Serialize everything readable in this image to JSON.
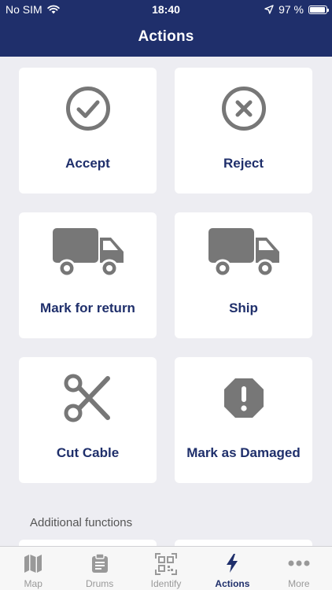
{
  "status_bar": {
    "carrier": "No SIM",
    "time": "18:40",
    "battery": "97 %",
    "icons": [
      "wifi-icon",
      "location-arrow-icon",
      "battery-icon"
    ]
  },
  "header": {
    "title": "Actions"
  },
  "actions": [
    {
      "label": "Accept",
      "icon": "check-circle-icon"
    },
    {
      "label": "Reject",
      "icon": "x-circle-icon"
    },
    {
      "label": "Mark for return",
      "icon": "truck-icon"
    },
    {
      "label": "Ship",
      "icon": "truck-icon"
    },
    {
      "label": "Cut Cable",
      "icon": "scissors-icon"
    },
    {
      "label": "Mark as Damaged",
      "icon": "alert-octagon-icon"
    }
  ],
  "additional": {
    "title": "Additional functions"
  },
  "tabbar": {
    "active": "Actions",
    "tabs": [
      {
        "label": "Map",
        "icon": "map-icon"
      },
      {
        "label": "Drums",
        "icon": "clipboard-icon"
      },
      {
        "label": "Identify",
        "icon": "qr-code-icon"
      },
      {
        "label": "Actions",
        "icon": "bolt-icon"
      },
      {
        "label": "More",
        "icon": "more-dots-icon"
      }
    ]
  },
  "colors": {
    "brand": "#1f2f6b",
    "icon_gray": "#777777",
    "background": "#ededf2"
  }
}
